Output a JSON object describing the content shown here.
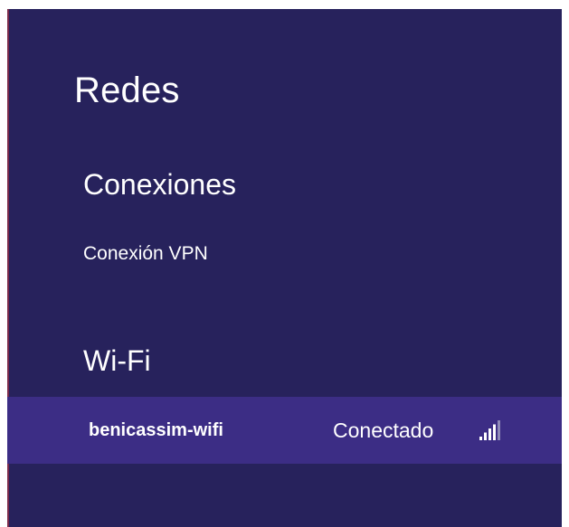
{
  "panel": {
    "title": "Redes"
  },
  "sections": {
    "connections": {
      "heading": "Conexiones",
      "items": [
        {
          "label": "Conexión VPN"
        }
      ]
    },
    "wifi": {
      "heading": "Wi-Fi",
      "networks": [
        {
          "name": "benicassim-wifi",
          "status": "Conectado",
          "signal_bars": 4,
          "signal_max": 5,
          "icon": "wifi-signal-icon"
        }
      ]
    }
  },
  "colors": {
    "background": "#27225c",
    "selected_row": "#3c2d85",
    "text": "#ffffff",
    "signal_inactive": "#8f8ab8"
  }
}
